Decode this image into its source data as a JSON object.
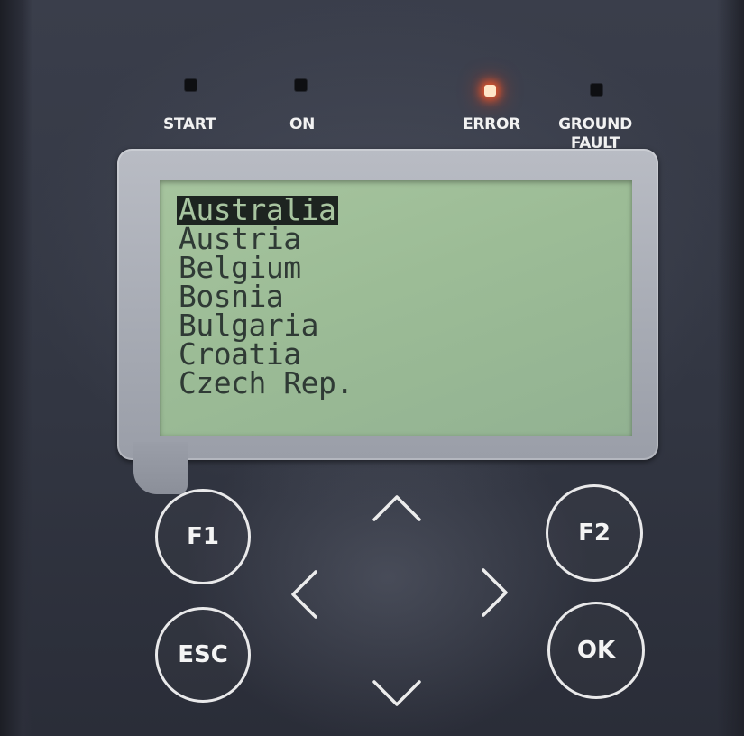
{
  "leds": [
    {
      "label": "START",
      "state": "off"
    },
    {
      "label": "ON",
      "state": "off"
    },
    {
      "label": "ERROR",
      "state": "on",
      "color": "#ff5a28"
    },
    {
      "label": "GROUND\nFAULT",
      "state": "off"
    }
  ],
  "screen": {
    "items": [
      "Australia",
      "Austria",
      "Belgium",
      "Bosnia",
      "Bulgaria",
      "Croatia",
      "Czech Rep."
    ],
    "selected_index": 0,
    "colors": {
      "background": "#9cbc96",
      "text": "#2f3a35"
    }
  },
  "buttons": {
    "f1": "F1",
    "f2": "F2",
    "esc": "ESC",
    "ok": "OK"
  },
  "nav": {
    "up_icon": "chevron-up-icon",
    "down_icon": "chevron-down-icon",
    "left_icon": "chevron-left-icon",
    "right_icon": "chevron-right-icon"
  }
}
